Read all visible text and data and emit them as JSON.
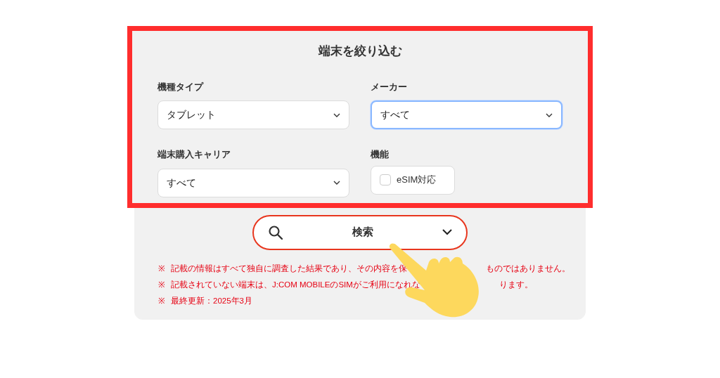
{
  "filter": {
    "title": "端末を絞り込む",
    "fields": [
      {
        "kind": "select",
        "label": "機種タイプ",
        "value": "タブレット",
        "focused": false
      },
      {
        "kind": "select",
        "label": "メーカー",
        "value": "すべて",
        "focused": true
      },
      {
        "kind": "select",
        "label": "端末購入キャリア",
        "value": "すべて",
        "focused": false
      },
      {
        "kind": "checkbox",
        "label": "機能",
        "option": "eSIM対応",
        "checked": false
      }
    ]
  },
  "search_button": {
    "label": "検索"
  },
  "notes": [
    {
      "mark": "※",
      "parts": [
        "記載の情報はすべて独自に調査した結果であり、その内容を保",
        "ものではありません。"
      ]
    },
    {
      "mark": "※",
      "parts": [
        "記載されていない端末は、J:COM MOBILEのSIMがご利用になれな",
        "ります。"
      ]
    },
    {
      "mark": "※",
      "parts": [
        "最終更新：2025年3月"
      ]
    }
  ]
}
